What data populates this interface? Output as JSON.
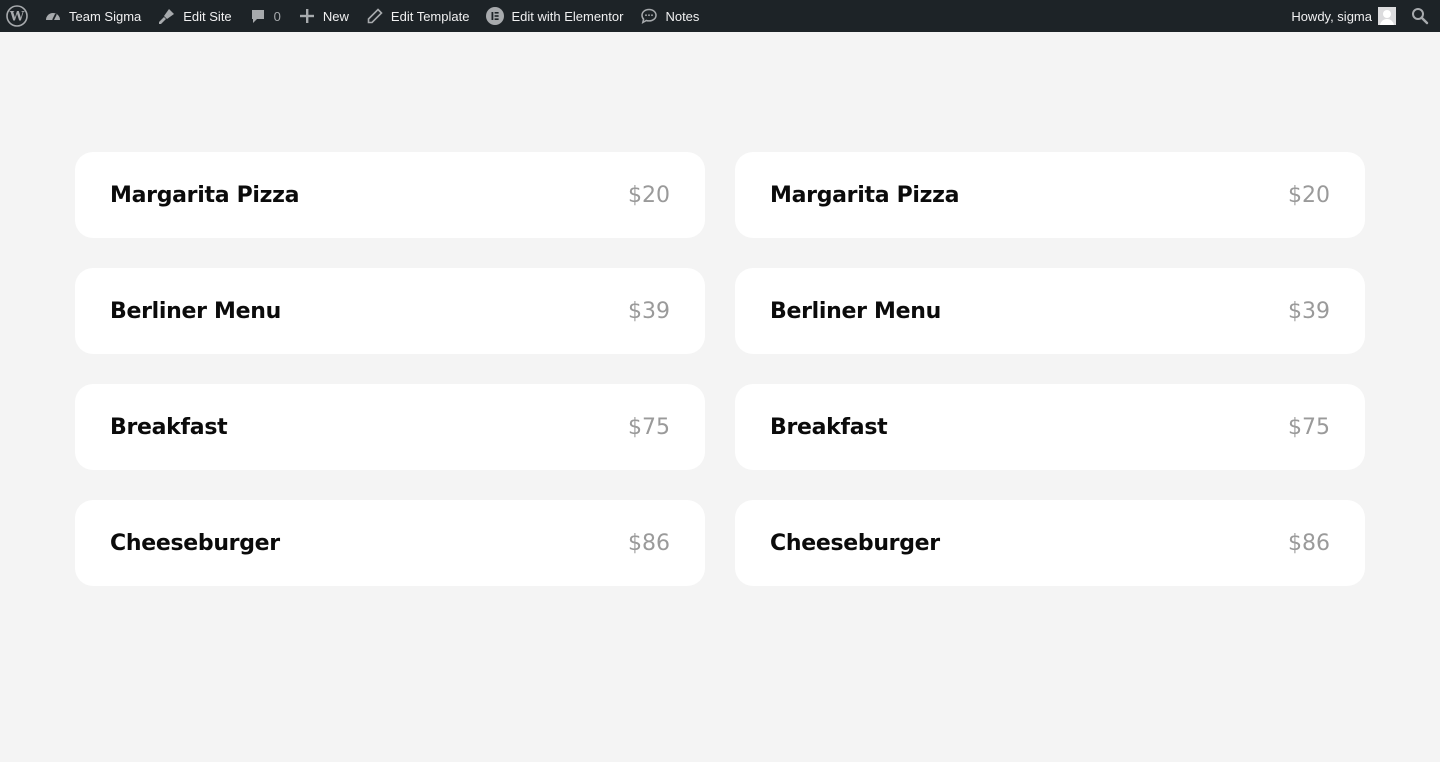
{
  "adminbar": {
    "wp_logo_icon": "wordpress-icon",
    "site_name": "Team Sigma",
    "site_icon": "dashboard-gauge-icon",
    "edit_site": "Edit Site",
    "edit_site_icon": "brush-icon",
    "comments_count": "0",
    "comments_icon": "comment-bubble-icon",
    "new_label": "New",
    "new_icon": "plus-icon",
    "edit_template": "Edit Template",
    "edit_template_icon": "pencil-icon",
    "edit_elementor": "Edit with Elementor",
    "edit_elementor_icon": "elementor-icon",
    "notes": "Notes",
    "notes_icon": "chat-bubble-icon",
    "howdy": "Howdy, sigma",
    "search_icon": "search-icon"
  },
  "menu": {
    "left": [
      {
        "name": "Margarita Pizza",
        "price": "$20"
      },
      {
        "name": "Berliner Menu",
        "price": "$39"
      },
      {
        "name": "Breakfast",
        "price": "$75"
      },
      {
        "name": "Cheeseburger",
        "price": "$86"
      }
    ],
    "right": [
      {
        "name": "Margarita Pizza",
        "price": "$20"
      },
      {
        "name": "Berliner Menu",
        "price": "$39"
      },
      {
        "name": "Breakfast",
        "price": "$75"
      },
      {
        "name": "Cheeseburger",
        "price": "$86"
      }
    ]
  },
  "colors": {
    "adminbar_bg": "#1d2327",
    "page_bg": "#f4f4f4",
    "card_bg": "#ffffff",
    "price_color": "#9a9a9a"
  }
}
